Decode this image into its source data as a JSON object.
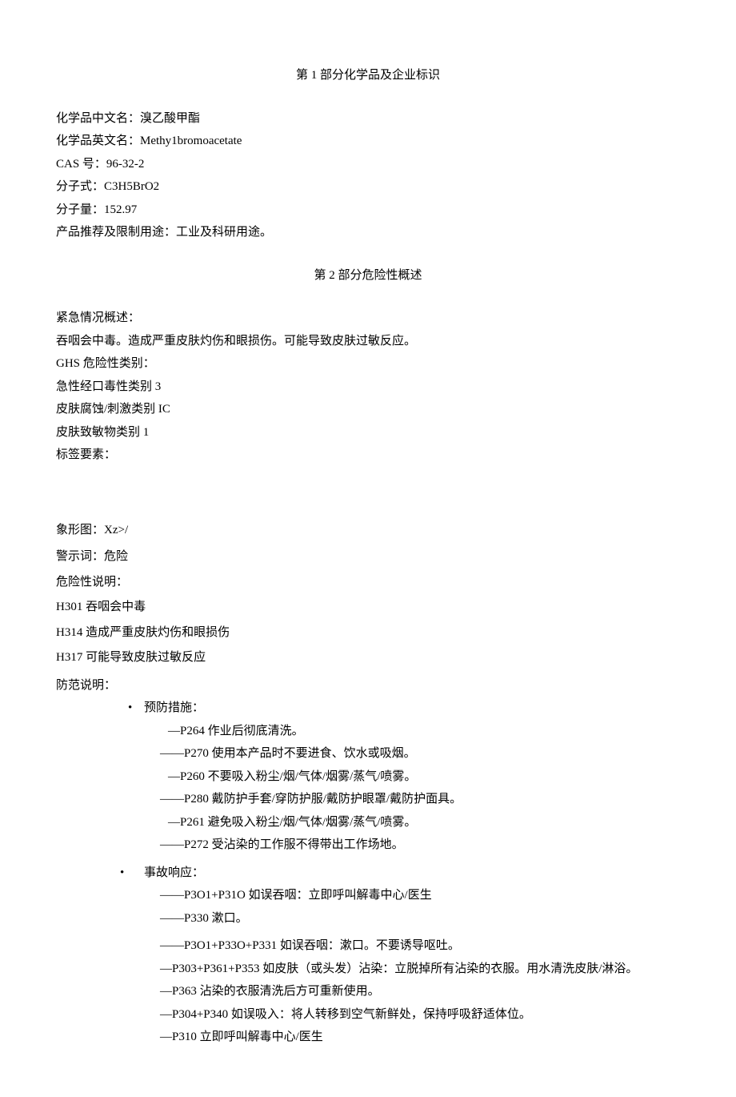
{
  "section1": {
    "title": "第 1 部分化学品及企业标识",
    "lines": {
      "l1": "化学品中文名：溴乙酸甲酯",
      "l2": "化学品英文名：Methy1bromoacetate",
      "l3": "CAS 号：96-32-2",
      "l4": "分子式：C3H5BrO2",
      "l5": "分子量：152.97",
      "l6": "产品推荐及限制用途：工业及科研用途。"
    }
  },
  "section2": {
    "title": "第 2 部分危险性概述",
    "overview_label": "紧急情况概述：",
    "overview_text": "吞咽会中毒。造成严重皮肤灼伤和眼损伤。可能导致皮肤过敏反应。",
    "ghs_label": "GHS 危险性类别：",
    "ghs_items": {
      "g1": "急性经口毒性类别 3",
      "g2": "皮肤腐蚀/刺激类别 IC",
      "g3": "皮肤致敏物类别 1"
    },
    "label_elements": "标签要素：",
    "pictogram": "象形图：Xz>/",
    "signal_word": "警示词：危险",
    "hazard_label": "危险性说明：",
    "hazard_items": {
      "h1": "H301 吞咽会中毒",
      "h2": "H314 造成严重皮肤灼伤和眼损伤",
      "h3": "H317 可能导致皮肤过敏反应"
    },
    "precaution_label": "防范说明：",
    "prevention": {
      "bullet": "•",
      "title": "预防措施：",
      "items": {
        "p1": "—P264 作业后彻底清洗。",
        "p2": "——P270 使用本产品时不要进食、饮水或吸烟。",
        "p3": "—P260 不要吸入粉尘/烟/气体/烟雾/蒸气/喷雾。",
        "p4": "——P280 戴防护手套/穿防护服/戴防护眼罩/戴防护面具。",
        "p5": "—P261 避免吸入粉尘/烟/气体/烟雾/蒸气/喷雾。",
        "p6": "——P272 受沾染的工作服不得带出工作场地。"
      }
    },
    "response": {
      "bullet": "•",
      "title": "事故响应：",
      "items": {
        "r1": "——P3O1+P31O 如误吞咽：立即呼叫解毒中心/医生",
        "r2": "——P330 漱口。",
        "r3": "——P3O1+P33O+P331 如误吞咽：漱口。不要诱导呕吐。",
        "r4": "—P303+P361+P353 如皮肤（或头发）沾染：立脱掉所有沾染的衣服。用水清洗皮肤/淋浴。",
        "r5": "—P363 沾染的衣服清洗后方可重新使用。",
        "r6": "—P304+P340 如误吸入：将人转移到空气新鲜处，保持呼吸舒适体位。",
        "r7": "—P310 立即呼叫解毒中心/医生"
      }
    }
  }
}
